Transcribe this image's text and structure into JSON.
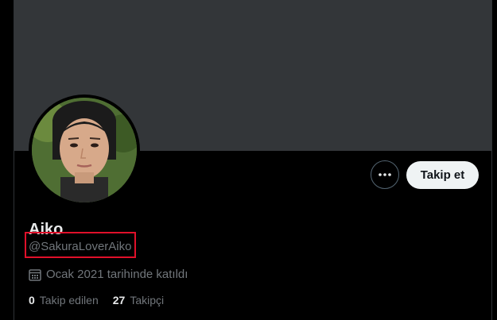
{
  "profile": {
    "display_name": "Aiko",
    "handle": "@SakuraLoverAiko",
    "joined": "Ocak 2021 tarihinde katıldı",
    "following_count": "0",
    "following_label": "Takip edilen",
    "followers_count": "27",
    "followers_label": "Takipçi"
  },
  "actions": {
    "more_icon": "more-horizontal-icon",
    "follow_label": "Takip et"
  },
  "colors": {
    "background": "#000000",
    "banner": "#333639",
    "highlight_box": "#e0102a",
    "secondary_text": "#71767b",
    "primary_text": "#e7e9ea",
    "follow_button": "#eff3f4"
  }
}
